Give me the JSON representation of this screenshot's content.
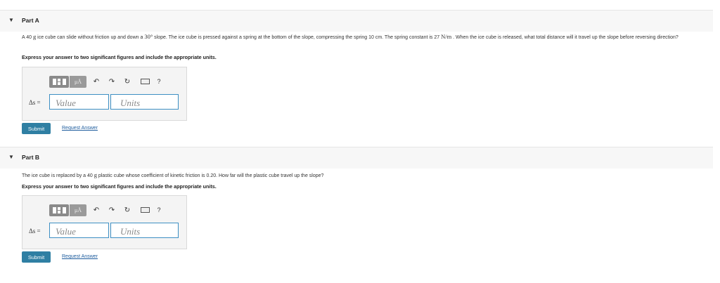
{
  "part_a": {
    "toggle_icon": "caret-down-icon",
    "title": "Part A",
    "question_pre": "A 40 ",
    "question_mass_unit": "g",
    "question_mid1": " ice cube can slide without friction up and down a ",
    "question_angle": "30°",
    "question_mid2": " slope. The ice cube is pressed against a spring at the bottom of the slope, compressing the spring 10 cm. The spring constant is 27 ",
    "question_spring_unit": "N/m",
    "question_post": " . When the ice cube is released, what total distance will it travel up the slope before reversing direction?",
    "instruction": "Express your answer to two significant figures and include the appropriate units.",
    "answer": {
      "label": "Δs =",
      "value_placeholder": "Value",
      "units_placeholder": "Units",
      "mu_label": "μÅ",
      "undo": "↶",
      "redo": "↷",
      "reset": "↻",
      "help": "?"
    },
    "submit_label": "Submit",
    "request_answer_label": "Request Answer"
  },
  "part_b": {
    "toggle_icon": "caret-down-icon",
    "title": "Part B",
    "question_pre": "The ice cube is replaced by a 40 ",
    "question_mass_unit": "g",
    "question_post": " plastic cube whose coefficient of kinetic friction is 0.20. How far will the plastic cube travel up the slope?",
    "instruction": "Express your answer to two significant figures and include the appropriate units.",
    "answer": {
      "label": "Δs =",
      "value_placeholder": "Value",
      "units_placeholder": "Units",
      "mu_label": "μÅ",
      "undo": "↶",
      "redo": "↷",
      "reset": "↻",
      "help": "?"
    },
    "submit_label": "Submit",
    "request_answer_label": "Request Answer"
  },
  "colors": {
    "submit": "#2f7fa3",
    "link": "#1f5d9e",
    "input_border": "#3d8fc3",
    "header_bg": "#f7f7f7"
  }
}
